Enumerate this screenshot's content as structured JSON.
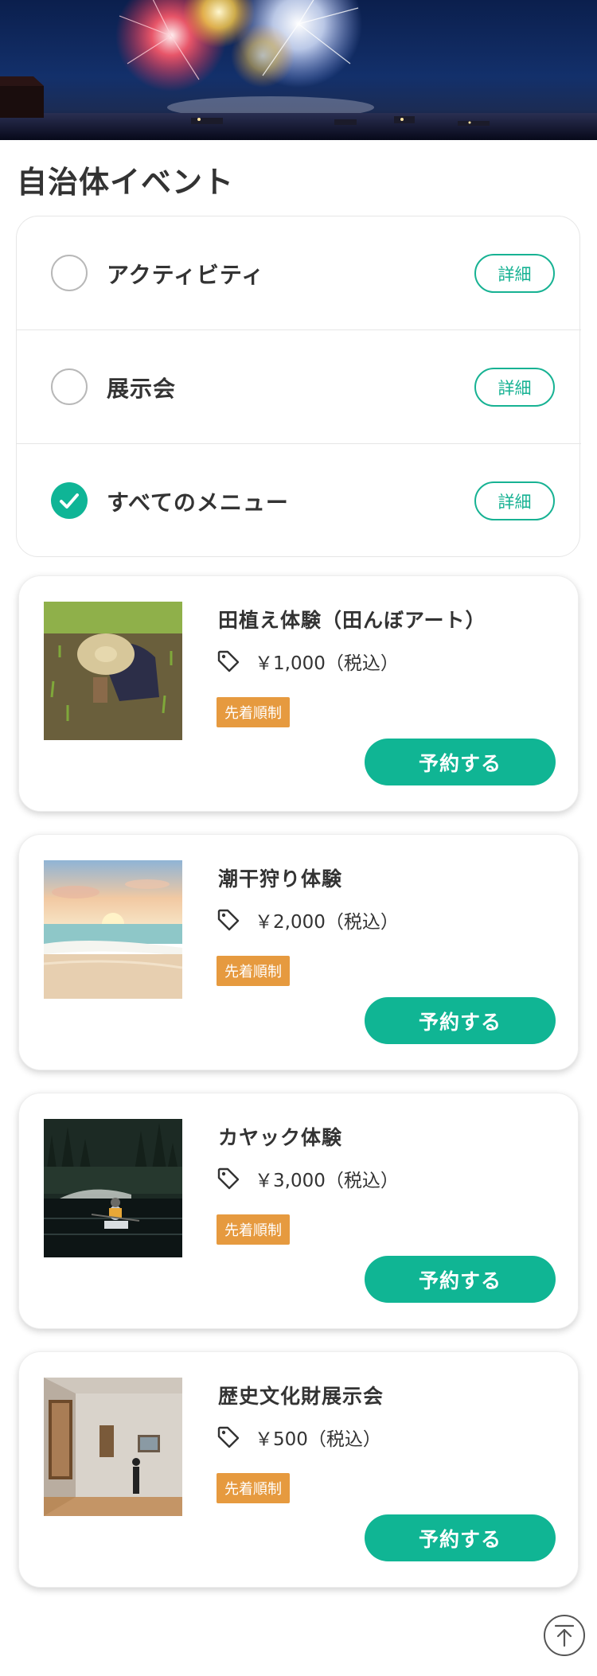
{
  "hero": {
    "image": "fireworks-over-harbor"
  },
  "section": {
    "title": "自治体イベント"
  },
  "filters": [
    {
      "label": "アクティビティ",
      "checked": false,
      "detail_label": "詳細"
    },
    {
      "label": "展示会",
      "checked": false,
      "detail_label": "詳細"
    },
    {
      "label": "すべてのメニュー",
      "checked": true,
      "detail_label": "詳細"
    }
  ],
  "events": [
    {
      "title": "田植え体験（田んぼアート）",
      "price": "￥1,000（税込）",
      "badge": "先着順制",
      "button": "予約する",
      "image": "rice-planting-photo"
    },
    {
      "title": "潮干狩り体験",
      "price": "￥2,000（税込）",
      "badge": "先着順制",
      "button": "予約する",
      "image": "beach-sunset-photo"
    },
    {
      "title": "カヤック体験",
      "price": "￥3,000（税込）",
      "badge": "先着順制",
      "button": "予約する",
      "image": "kayak-lake-photo"
    },
    {
      "title": "歴史文化財展示会",
      "price": "￥500（税込）",
      "badge": "先着順制",
      "button": "予約する",
      "image": "museum-gallery-photo"
    }
  ],
  "colors": {
    "accent": "#10b594",
    "badge": "#e69a3f",
    "text": "#333333"
  },
  "icons": {
    "price": "tag-icon",
    "scroll_top": "arrow-up-circle-icon",
    "check": "check-icon"
  }
}
